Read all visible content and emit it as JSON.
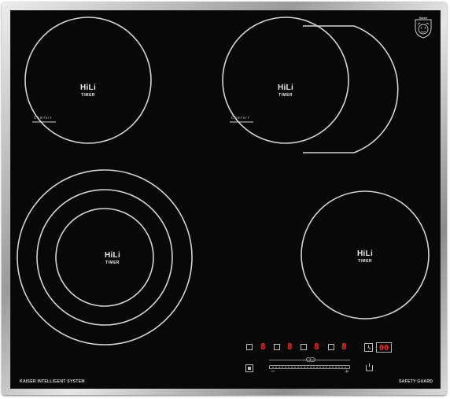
{
  "zones": [
    {
      "brand": "HiLi",
      "subtitle": "TIMER",
      "comfort": "Comfort"
    },
    {
      "brand": "HiLi",
      "subtitle": "TIMER",
      "comfort": "Comfort"
    },
    {
      "brand": "HiLi",
      "subtitle": "TIMER"
    },
    {
      "brand": "HiLi",
      "subtitle": "TIMER"
    }
  ],
  "logo": {
    "text": "Kaiser"
  },
  "controls": {
    "zone_levels": [
      "8",
      "8",
      "8",
      "8"
    ],
    "timer_value": "00",
    "slider_minus": "−",
    "slider_plus": "+"
  },
  "footer": {
    "left": "KAISER INTELLIGENT SYSTEM",
    "right": "SAFETY GUARD"
  },
  "colors": {
    "glass": "#080808",
    "ring": "#d4d4d4",
    "digit": "#ff2a2a",
    "frame": "#b5b5b5"
  },
  "icons": [
    "lock-icon",
    "clock-icon",
    "power-icon",
    "dual-zone-icon"
  ]
}
